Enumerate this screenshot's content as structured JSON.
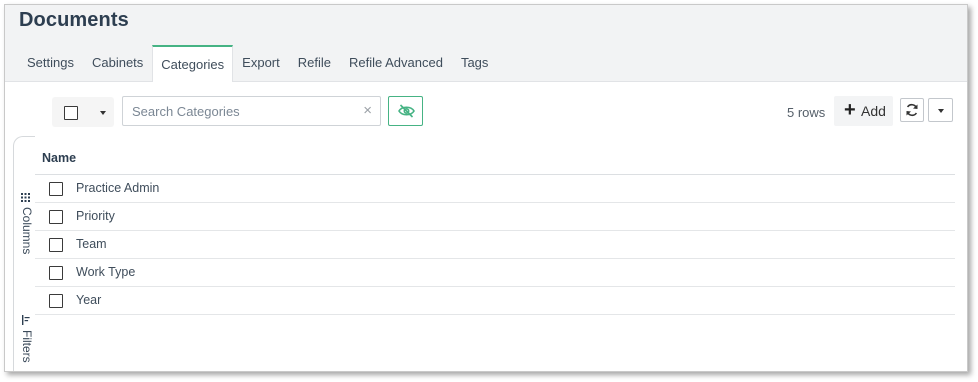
{
  "page": {
    "title": "Documents"
  },
  "tabs": [
    {
      "label": "Settings",
      "active": false
    },
    {
      "label": "Cabinets",
      "active": false
    },
    {
      "label": "Categories",
      "active": true
    },
    {
      "label": "Export",
      "active": false
    },
    {
      "label": "Refile",
      "active": false
    },
    {
      "label": "Refile Advanced",
      "active": false
    },
    {
      "label": "Tags",
      "active": false
    }
  ],
  "toolbar": {
    "search_placeholder": "Search Categories",
    "search_value": "",
    "clear_glyph": "×",
    "rows_count": "5 rows",
    "add_label": "Add",
    "add_glyph": "+",
    "accent_color": "#46b384",
    "icons": [
      "eye-off-icon",
      "refresh-icon",
      "caret-down-icon"
    ]
  },
  "side_panel": {
    "columns_label": "Columns",
    "filters_label": "Filters"
  },
  "table": {
    "header": {
      "name": "Name"
    },
    "rows": [
      {
        "name": "Practice Admin"
      },
      {
        "name": "Priority"
      },
      {
        "name": "Team"
      },
      {
        "name": "Work Type"
      },
      {
        "name": "Year"
      }
    ]
  }
}
